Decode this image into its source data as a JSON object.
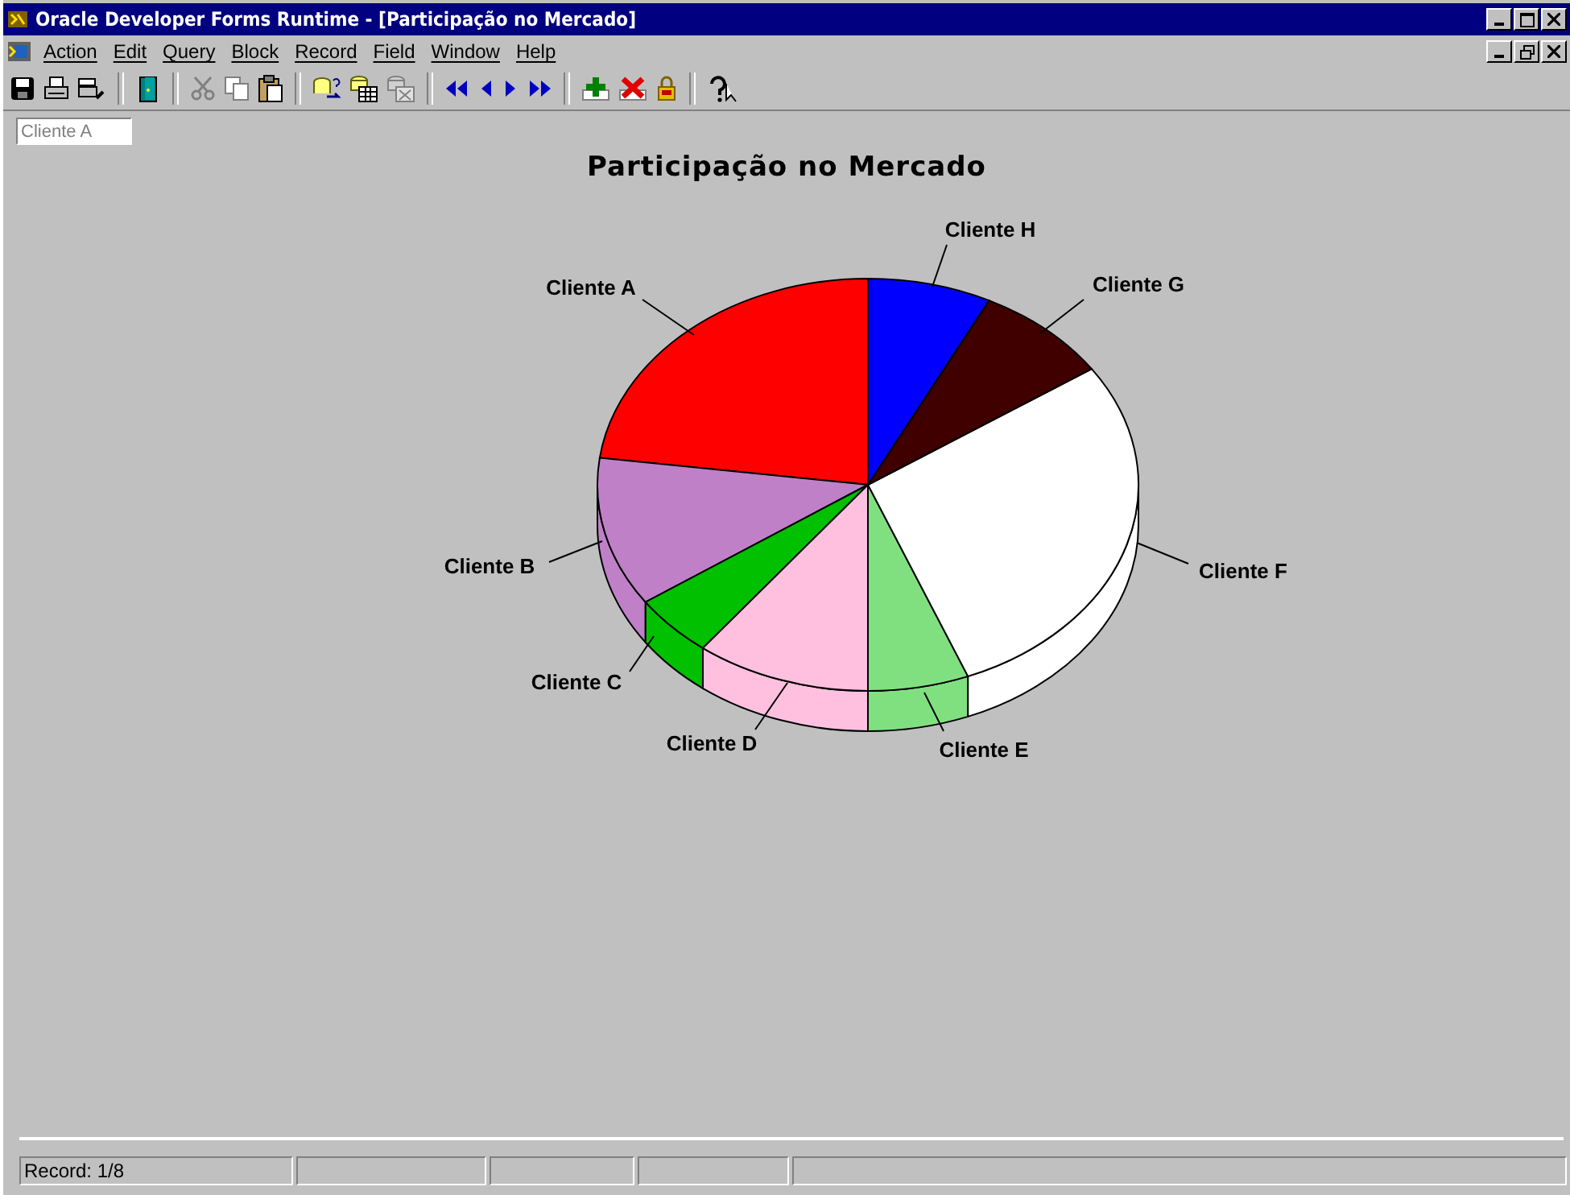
{
  "window": {
    "title": "Oracle Developer Forms Runtime - [Participação no Mercado]"
  },
  "menu": [
    {
      "label": "Action"
    },
    {
      "label": "Edit"
    },
    {
      "label": "Query"
    },
    {
      "label": "Block"
    },
    {
      "label": "Record"
    },
    {
      "label": "Field"
    },
    {
      "label": "Window"
    },
    {
      "label": "Help"
    }
  ],
  "field": {
    "value": "Cliente A"
  },
  "chart": {
    "title": "Participação no Mercado",
    "slices": [
      {
        "label": "Cliente A",
        "color": "#ff0000"
      },
      {
        "label": "Cliente B",
        "color": "#c080c8"
      },
      {
        "label": "Cliente C",
        "color": "#00c000"
      },
      {
        "label": "Cliente D",
        "color": "#ffc0e0"
      },
      {
        "label": "Cliente E",
        "color": "#80e080"
      },
      {
        "label": "Cliente F",
        "color": "#ffffff"
      },
      {
        "label": "Cliente G",
        "color": "#400000"
      },
      {
        "label": "Cliente H",
        "color": "#0000ff"
      }
    ]
  },
  "status_bar": {
    "record": "Record: 1/8"
  }
}
